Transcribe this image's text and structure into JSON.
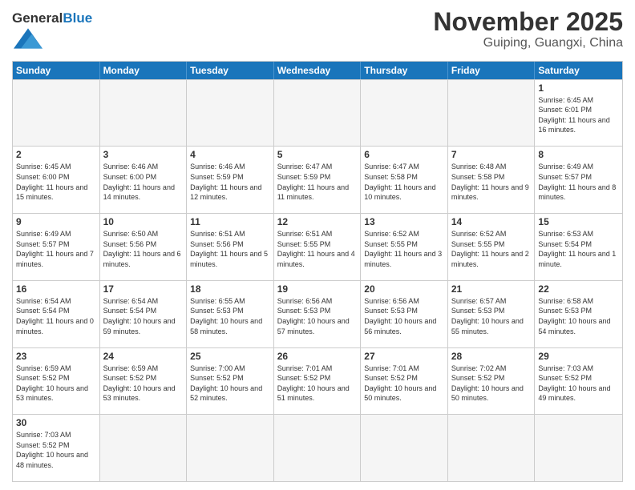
{
  "header": {
    "logo_general": "General",
    "logo_blue": "Blue",
    "month_title": "November 2025",
    "location": "Guiping, Guangxi, China"
  },
  "weekdays": [
    "Sunday",
    "Monday",
    "Tuesday",
    "Wednesday",
    "Thursday",
    "Friday",
    "Saturday"
  ],
  "weeks": [
    [
      {
        "day": "",
        "info": ""
      },
      {
        "day": "",
        "info": ""
      },
      {
        "day": "",
        "info": ""
      },
      {
        "day": "",
        "info": ""
      },
      {
        "day": "",
        "info": ""
      },
      {
        "day": "",
        "info": ""
      },
      {
        "day": "1",
        "info": "Sunrise: 6:45 AM\nSunset: 6:01 PM\nDaylight: 11 hours\nand 16 minutes."
      }
    ],
    [
      {
        "day": "2",
        "info": "Sunrise: 6:45 AM\nSunset: 6:00 PM\nDaylight: 11 hours\nand 15 minutes."
      },
      {
        "day": "3",
        "info": "Sunrise: 6:46 AM\nSunset: 6:00 PM\nDaylight: 11 hours\nand 14 minutes."
      },
      {
        "day": "4",
        "info": "Sunrise: 6:46 AM\nSunset: 5:59 PM\nDaylight: 11 hours\nand 12 minutes."
      },
      {
        "day": "5",
        "info": "Sunrise: 6:47 AM\nSunset: 5:59 PM\nDaylight: 11 hours\nand 11 minutes."
      },
      {
        "day": "6",
        "info": "Sunrise: 6:47 AM\nSunset: 5:58 PM\nDaylight: 11 hours\nand 10 minutes."
      },
      {
        "day": "7",
        "info": "Sunrise: 6:48 AM\nSunset: 5:58 PM\nDaylight: 11 hours\nand 9 minutes."
      },
      {
        "day": "8",
        "info": "Sunrise: 6:49 AM\nSunset: 5:57 PM\nDaylight: 11 hours\nand 8 minutes."
      }
    ],
    [
      {
        "day": "9",
        "info": "Sunrise: 6:49 AM\nSunset: 5:57 PM\nDaylight: 11 hours\nand 7 minutes."
      },
      {
        "day": "10",
        "info": "Sunrise: 6:50 AM\nSunset: 5:56 PM\nDaylight: 11 hours\nand 6 minutes."
      },
      {
        "day": "11",
        "info": "Sunrise: 6:51 AM\nSunset: 5:56 PM\nDaylight: 11 hours\nand 5 minutes."
      },
      {
        "day": "12",
        "info": "Sunrise: 6:51 AM\nSunset: 5:55 PM\nDaylight: 11 hours\nand 4 minutes."
      },
      {
        "day": "13",
        "info": "Sunrise: 6:52 AM\nSunset: 5:55 PM\nDaylight: 11 hours\nand 3 minutes."
      },
      {
        "day": "14",
        "info": "Sunrise: 6:52 AM\nSunset: 5:55 PM\nDaylight: 11 hours\nand 2 minutes."
      },
      {
        "day": "15",
        "info": "Sunrise: 6:53 AM\nSunset: 5:54 PM\nDaylight: 11 hours\nand 1 minute."
      }
    ],
    [
      {
        "day": "16",
        "info": "Sunrise: 6:54 AM\nSunset: 5:54 PM\nDaylight: 11 hours\nand 0 minutes."
      },
      {
        "day": "17",
        "info": "Sunrise: 6:54 AM\nSunset: 5:54 PM\nDaylight: 10 hours\nand 59 minutes."
      },
      {
        "day": "18",
        "info": "Sunrise: 6:55 AM\nSunset: 5:53 PM\nDaylight: 10 hours\nand 58 minutes."
      },
      {
        "day": "19",
        "info": "Sunrise: 6:56 AM\nSunset: 5:53 PM\nDaylight: 10 hours\nand 57 minutes."
      },
      {
        "day": "20",
        "info": "Sunrise: 6:56 AM\nSunset: 5:53 PM\nDaylight: 10 hours\nand 56 minutes."
      },
      {
        "day": "21",
        "info": "Sunrise: 6:57 AM\nSunset: 5:53 PM\nDaylight: 10 hours\nand 55 minutes."
      },
      {
        "day": "22",
        "info": "Sunrise: 6:58 AM\nSunset: 5:53 PM\nDaylight: 10 hours\nand 54 minutes."
      }
    ],
    [
      {
        "day": "23",
        "info": "Sunrise: 6:59 AM\nSunset: 5:52 PM\nDaylight: 10 hours\nand 53 minutes."
      },
      {
        "day": "24",
        "info": "Sunrise: 6:59 AM\nSunset: 5:52 PM\nDaylight: 10 hours\nand 53 minutes."
      },
      {
        "day": "25",
        "info": "Sunrise: 7:00 AM\nSunset: 5:52 PM\nDaylight: 10 hours\nand 52 minutes."
      },
      {
        "day": "26",
        "info": "Sunrise: 7:01 AM\nSunset: 5:52 PM\nDaylight: 10 hours\nand 51 minutes."
      },
      {
        "day": "27",
        "info": "Sunrise: 7:01 AM\nSunset: 5:52 PM\nDaylight: 10 hours\nand 50 minutes."
      },
      {
        "day": "28",
        "info": "Sunrise: 7:02 AM\nSunset: 5:52 PM\nDaylight: 10 hours\nand 50 minutes."
      },
      {
        "day": "29",
        "info": "Sunrise: 7:03 AM\nSunset: 5:52 PM\nDaylight: 10 hours\nand 49 minutes."
      }
    ],
    [
      {
        "day": "30",
        "info": "Sunrise: 7:03 AM\nSunset: 5:52 PM\nDaylight: 10 hours\nand 48 minutes."
      },
      {
        "day": "",
        "info": ""
      },
      {
        "day": "",
        "info": ""
      },
      {
        "day": "",
        "info": ""
      },
      {
        "day": "",
        "info": ""
      },
      {
        "day": "",
        "info": ""
      },
      {
        "day": "",
        "info": ""
      }
    ]
  ]
}
